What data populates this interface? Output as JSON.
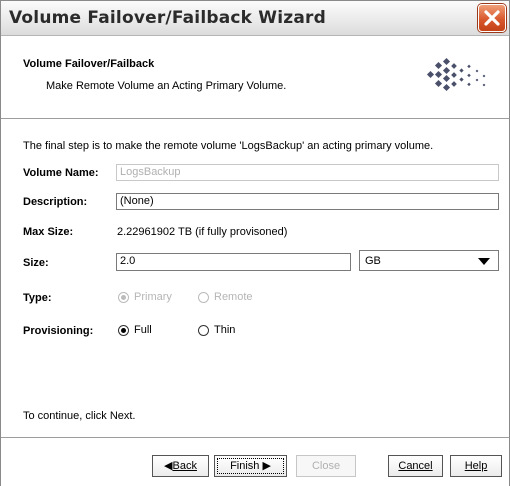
{
  "window": {
    "title": "Volume Failover/Failback Wizard"
  },
  "header": {
    "title": "Volume Failover/Failback",
    "subtitle": "Make Remote Volume an Acting Primary Volume."
  },
  "intro": "The final step is to make the remote volume 'LogsBackup' an acting primary volume.",
  "form": {
    "volume_name": {
      "label": "Volume Name:",
      "value": "LogsBackup"
    },
    "description": {
      "label": "Description:",
      "value": "(None)"
    },
    "max_size": {
      "label": "Max Size:",
      "value": "2.22961902 TB (if fully provisoned)"
    },
    "size": {
      "label": "Size:",
      "value": "2.0",
      "unit": "GB"
    },
    "type": {
      "label": "Type:",
      "options": [
        "Primary",
        "Remote"
      ],
      "selected": "Primary",
      "enabled": false
    },
    "provisioning": {
      "label": "Provisioning:",
      "options": [
        "Full",
        "Thin"
      ],
      "selected": "Full",
      "enabled": true
    }
  },
  "continue_text": "To continue, click Next.",
  "buttons": {
    "back": "Back",
    "finish": "Finish",
    "close": "Close",
    "cancel": "Cancel",
    "help": "Help"
  },
  "icons": {
    "close": "close-x-icon",
    "logo": "diamond-dots-logo"
  },
  "colors": {
    "close_button": "#d9582d",
    "disabled_text": "#b0b0b0"
  }
}
